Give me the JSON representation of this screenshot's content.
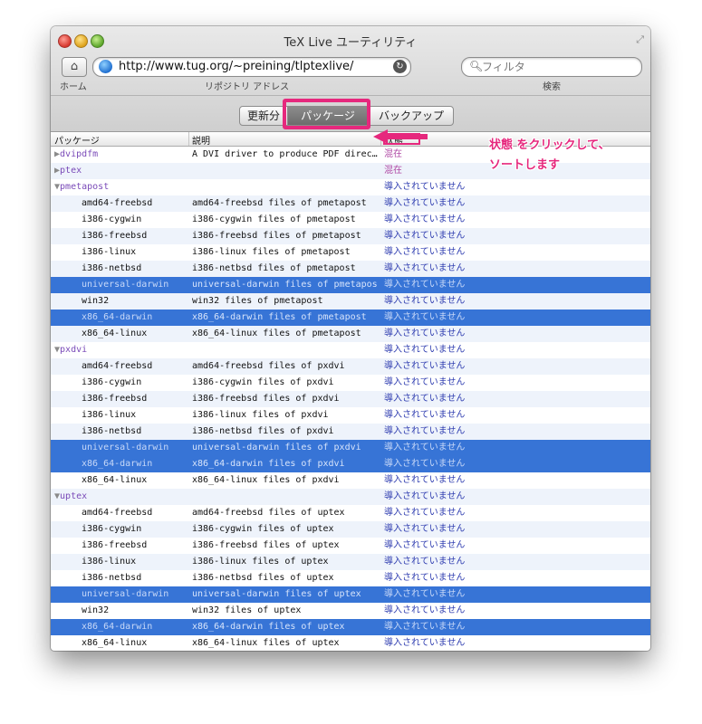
{
  "window": {
    "title": "TeX Live ユーティリティ"
  },
  "toolbar": {
    "url": "http://www.tug.org/~preining/tlptexlive/",
    "search_placeholder": "フィルタ",
    "home_label": "ホーム",
    "repo_label": "リポジトリ アドレス",
    "search_label": "検索"
  },
  "segments": {
    "updates": "更新分",
    "packages": "パッケージ",
    "backup": "バックアップ"
  },
  "columns": {
    "package": "パッケージ",
    "description": "説明",
    "status": "状態"
  },
  "annotation": {
    "line1": "状態 をクリックして、",
    "line2": "ソートします"
  },
  "colors": {
    "accent": "#e6287d",
    "selection": "#3774d6"
  },
  "rows": [
    {
      "name": "dvipdfm",
      "desc": "A DVI driver to produce PDF direc…",
      "status": "混在",
      "kind": "group-collapsed"
    },
    {
      "name": "ptex",
      "desc": "",
      "status": "混在",
      "kind": "group-collapsed"
    },
    {
      "name": "pmetapost",
      "desc": "",
      "status": "導入されていません",
      "kind": "group-expanded"
    },
    {
      "name": "amd64-freebsd",
      "desc": "amd64-freebsd files of pmetapost",
      "status": "導入されていません",
      "kind": "child"
    },
    {
      "name": "i386-cygwin",
      "desc": "i386-cygwin files of pmetapost",
      "status": "導入されていません",
      "kind": "child"
    },
    {
      "name": "i386-freebsd",
      "desc": "i386-freebsd files of pmetapost",
      "status": "導入されていません",
      "kind": "child"
    },
    {
      "name": "i386-linux",
      "desc": "i386-linux files of pmetapost",
      "status": "導入されていません",
      "kind": "child"
    },
    {
      "name": "i386-netbsd",
      "desc": "i386-netbsd files of pmetapost",
      "status": "導入されていません",
      "kind": "child"
    },
    {
      "name": "universal-darwin",
      "desc": "universal-darwin files of pmetapost",
      "status": "導入されていません",
      "kind": "child",
      "selected": true
    },
    {
      "name": "win32",
      "desc": "win32 files of pmetapost",
      "status": "導入されていません",
      "kind": "child"
    },
    {
      "name": "x86_64-darwin",
      "desc": "x86_64-darwin files of pmetapost",
      "status": "導入されていません",
      "kind": "child",
      "selected": true
    },
    {
      "name": "x86_64-linux",
      "desc": "x86_64-linux files of pmetapost",
      "status": "導入されていません",
      "kind": "child"
    },
    {
      "name": "pxdvi",
      "desc": "",
      "status": "導入されていません",
      "kind": "group-expanded"
    },
    {
      "name": "amd64-freebsd",
      "desc": "amd64-freebsd files of pxdvi",
      "status": "導入されていません",
      "kind": "child"
    },
    {
      "name": "i386-cygwin",
      "desc": "i386-cygwin files of pxdvi",
      "status": "導入されていません",
      "kind": "child"
    },
    {
      "name": "i386-freebsd",
      "desc": "i386-freebsd files of pxdvi",
      "status": "導入されていません",
      "kind": "child"
    },
    {
      "name": "i386-linux",
      "desc": "i386-linux files of pxdvi",
      "status": "導入されていません",
      "kind": "child"
    },
    {
      "name": "i386-netbsd",
      "desc": "i386-netbsd files of pxdvi",
      "status": "導入されていません",
      "kind": "child"
    },
    {
      "name": "universal-darwin",
      "desc": "universal-darwin files of pxdvi",
      "status": "導入されていません",
      "kind": "child",
      "selected": true
    },
    {
      "name": "x86_64-darwin",
      "desc": "x86_64-darwin files of pxdvi",
      "status": "導入されていません",
      "kind": "child",
      "selected": true
    },
    {
      "name": "x86_64-linux",
      "desc": "x86_64-linux files of pxdvi",
      "status": "導入されていません",
      "kind": "child"
    },
    {
      "name": "uptex",
      "desc": "",
      "status": "導入されていません",
      "kind": "group-expanded"
    },
    {
      "name": "amd64-freebsd",
      "desc": "amd64-freebsd files of uptex",
      "status": "導入されていません",
      "kind": "child"
    },
    {
      "name": "i386-cygwin",
      "desc": "i386-cygwin files of uptex",
      "status": "導入されていません",
      "kind": "child"
    },
    {
      "name": "i386-freebsd",
      "desc": "i386-freebsd files of uptex",
      "status": "導入されていません",
      "kind": "child"
    },
    {
      "name": "i386-linux",
      "desc": "i386-linux files of uptex",
      "status": "導入されていません",
      "kind": "child"
    },
    {
      "name": "i386-netbsd",
      "desc": "i386-netbsd files of uptex",
      "status": "導入されていません",
      "kind": "child"
    },
    {
      "name": "universal-darwin",
      "desc": "universal-darwin files of uptex",
      "status": "導入されていません",
      "kind": "child",
      "selected": true
    },
    {
      "name": "win32",
      "desc": "win32 files of uptex",
      "status": "導入されていません",
      "kind": "child"
    },
    {
      "name": "x86_64-darwin",
      "desc": "x86_64-darwin files of uptex",
      "status": "導入されていません",
      "kind": "child",
      "selected": true
    },
    {
      "name": "x86_64-linux",
      "desc": "x86_64-linux files of uptex",
      "status": "導入されていません",
      "kind": "child"
    }
  ]
}
